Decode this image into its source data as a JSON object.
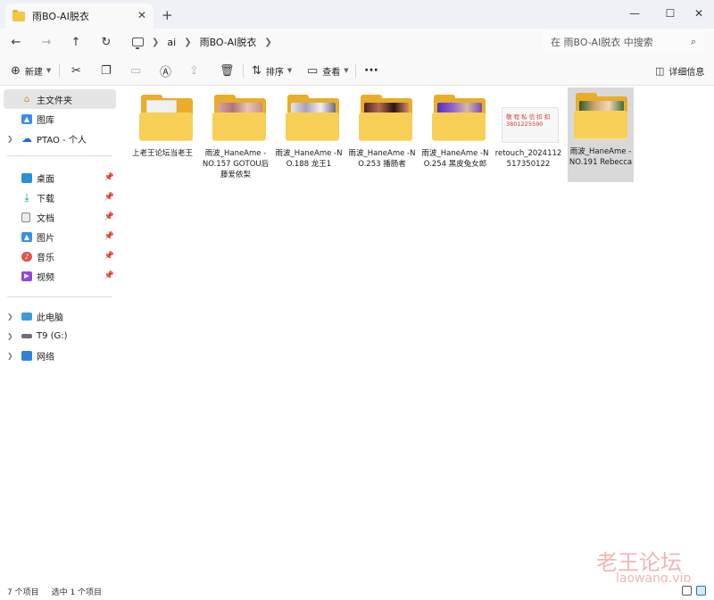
{
  "window": {
    "tab_title": "雨BO-AI脱衣",
    "tab_close": "✕",
    "new_tab": "+",
    "minimize": "—",
    "maximize": "☐",
    "close": "✕"
  },
  "address": {
    "back": "←",
    "forward": "→",
    "up": "↑",
    "refresh": "↻",
    "breadcrumb": [
      "ai",
      "雨BO-AI脱衣"
    ],
    "search_placeholder": "在 雨BO-AI脱衣 中搜索"
  },
  "toolbar": {
    "new_label": "新建",
    "sort_label": "排序",
    "view_label": "查看",
    "more_label": "···",
    "details_label": "详细信息"
  },
  "sidebar": {
    "quick": [
      {
        "label": "主文件夹",
        "icon": "home-icon"
      },
      {
        "label": "图库",
        "icon": "gallery-icon"
      },
      {
        "label": "PTAO - 个人",
        "icon": "cloud-icon"
      }
    ],
    "pinned": [
      {
        "label": "桌面",
        "icon": "desktop-icon"
      },
      {
        "label": "下载",
        "icon": "download-icon"
      },
      {
        "label": "文档",
        "icon": "document-icon"
      },
      {
        "label": "图片",
        "icon": "pictures-icon"
      },
      {
        "label": "音乐",
        "icon": "music-icon"
      },
      {
        "label": "视频",
        "icon": "video-icon"
      }
    ],
    "devices": [
      {
        "label": "此电脑",
        "icon": "pc-icon"
      },
      {
        "label": "T9 (G:)",
        "icon": "drive-icon"
      },
      {
        "label": "网络",
        "icon": "network-icon"
      }
    ]
  },
  "files": [
    {
      "name": "上老王论坛当老王",
      "type": "folder",
      "thumb": "paper"
    },
    {
      "name": "雨波_HaneAme - NO.157 GOTOU后藤爱依梨",
      "type": "folder",
      "thumb": "photo-pink"
    },
    {
      "name": "雨波_HaneAme -NO.188 龙王1",
      "type": "folder",
      "thumb": "photo-light"
    },
    {
      "name": "雨波_HaneAme -NO.253 播肠者",
      "type": "folder",
      "thumb": "photo-dark"
    },
    {
      "name": "雨波_HaneAme -NO.254 黑皮兔女郎",
      "type": "folder",
      "thumb": "photo-purple"
    },
    {
      "name": "retouch_2024112517350122",
      "type": "image",
      "image_text": "敬 程 私 信 扣 扣 3801225590"
    },
    {
      "name": "雨波_HaneAme -NO.191 Rebecca",
      "type": "folder",
      "thumb": "photo-green",
      "selected": true
    }
  ],
  "status": {
    "count": "7 个项目",
    "selected": "选中 1 个项目"
  },
  "watermark": {
    "main": "老王论坛",
    "sub": "laowang.vip"
  },
  "colors": {
    "folder_front": "#f8cf56",
    "folder_back": "#e9ad2a",
    "selection": "#d9d9d9",
    "watermark": "#f2b6b6"
  }
}
